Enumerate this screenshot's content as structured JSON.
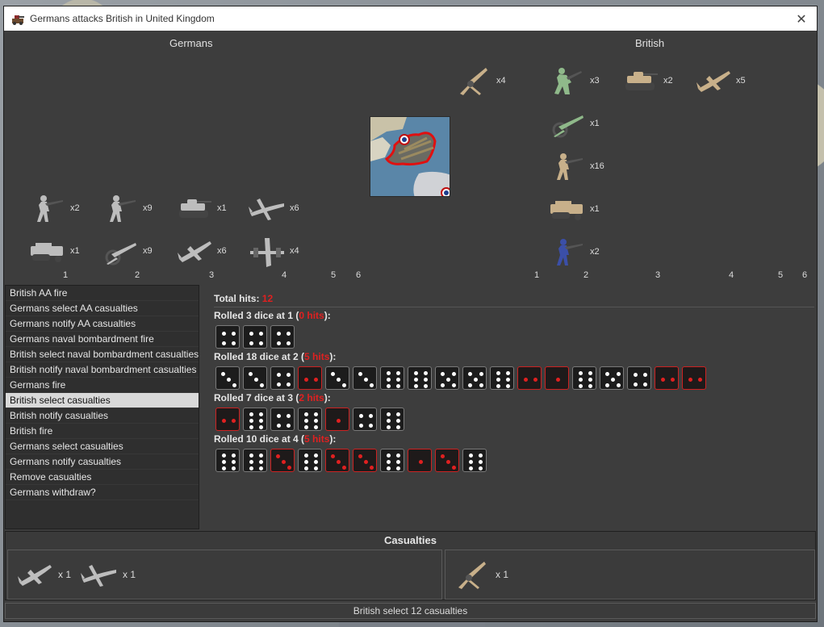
{
  "window": {
    "title": "Germans attacks British in United Kingdom"
  },
  "sides": {
    "attacker": "Germans",
    "defender": "British"
  },
  "german_units": [
    {
      "icon": "infantry-icon",
      "count": "x2"
    },
    {
      "icon": "infantry-icon",
      "count": "x9"
    },
    {
      "icon": "tank-icon",
      "count": "x1"
    },
    {
      "icon": "bomber-icon",
      "count": "x6"
    },
    {
      "icon": "halftrack-icon",
      "count": "x1"
    },
    {
      "icon": "artillery-icon",
      "count": "x9"
    },
    {
      "icon": "fighter-icon",
      "count": "x6"
    },
    {
      "icon": "heavy-bomber-icon",
      "count": "x4"
    }
  ],
  "british_units": [
    {
      "icon": "aa-gun-icon",
      "count": "x4"
    },
    {
      "icon": "marine-icon",
      "count": "x3"
    },
    {
      "icon": "tank-icon",
      "count": "x2"
    },
    {
      "icon": "fighter-icon",
      "count": "x5"
    },
    {
      "icon": "artillery-icon",
      "count": "x1"
    },
    {
      "icon": "infantry-icon",
      "count": "x16"
    },
    {
      "icon": "halftrack-icon",
      "count": "x1"
    },
    {
      "icon": "infantry-icon",
      "count": "x2"
    }
  ],
  "german_columns": [
    "1",
    "2",
    "3",
    "4",
    "5",
    "6"
  ],
  "british_columns": [
    "1",
    "2",
    "3",
    "4",
    "5",
    "6"
  ],
  "steps": [
    "British AA fire",
    "Germans select AA casualties",
    "Germans notify AA casualties",
    "Germans naval bombardment fire",
    "British select naval bombardment casualties",
    "British notify naval bombardment casualties",
    "Germans fire",
    "British select casualties",
    "British notify casualties",
    "British fire",
    "Germans select casualties",
    "Germans notify casualties",
    "Remove casualties",
    "Germans withdraw?"
  ],
  "selected_step": 7,
  "results": {
    "total_label": "Total hits:",
    "total_value": "12",
    "rolls": [
      {
        "prefix": "Rolled 3 dice at 1 (",
        "hits": "0 hits",
        "suffix": "):",
        "dice": [
          4,
          4,
          4
        ],
        "hit_mask": [
          0,
          0,
          0
        ]
      },
      {
        "prefix": "Rolled 18 dice at 2 (",
        "hits": "5 hits",
        "suffix": "):",
        "dice": [
          3,
          3,
          4,
          2,
          3,
          3,
          6,
          6,
          5,
          5,
          6,
          2,
          1,
          6,
          5,
          4,
          2,
          2
        ],
        "hit_mask": [
          0,
          0,
          0,
          1,
          0,
          0,
          0,
          0,
          0,
          0,
          0,
          1,
          1,
          0,
          0,
          0,
          1,
          1
        ]
      },
      {
        "prefix": "Rolled 7 dice at 3 (",
        "hits": "2 hits",
        "suffix": "):",
        "dice": [
          2,
          6,
          4,
          6,
          1,
          4,
          6
        ],
        "hit_mask": [
          1,
          0,
          0,
          0,
          1,
          0,
          0
        ]
      },
      {
        "prefix": "Rolled 10 dice at 4 (",
        "hits": "5 hits",
        "suffix": "):",
        "dice": [
          6,
          6,
          3,
          6,
          3,
          3,
          6,
          1,
          3,
          6
        ],
        "hit_mask": [
          0,
          0,
          1,
          0,
          1,
          1,
          0,
          1,
          1,
          0
        ]
      }
    ]
  },
  "casualties": {
    "title": "Casualties",
    "attacker": [
      {
        "icon": "fighter-icon",
        "count": "x 1"
      },
      {
        "icon": "bomber-icon",
        "count": "x 1"
      }
    ],
    "defender": [
      {
        "icon": "aa-gun-icon",
        "count": "x 1"
      }
    ]
  },
  "status": "British select 12 casualties",
  "colors": {
    "hit": "#e02020",
    "selected_row": "#d9d9d9",
    "window_bg": "#3d3d3d"
  }
}
